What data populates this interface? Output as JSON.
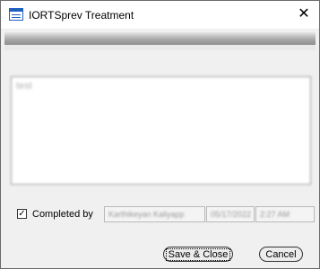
{
  "window": {
    "title": "IORTSprev Treatment",
    "app_icon": "table-form-icon",
    "close_glyph": "✕"
  },
  "notes": {
    "text": "test"
  },
  "completion": {
    "checked": true,
    "check_glyph": "✓",
    "label": "Completed by",
    "user_name": "Karthikeyan Kaliyapp",
    "date": "05/17/2022",
    "time": "2:27 AM"
  },
  "buttons": {
    "save_close": "Save & Close",
    "cancel": "Cancel"
  }
}
